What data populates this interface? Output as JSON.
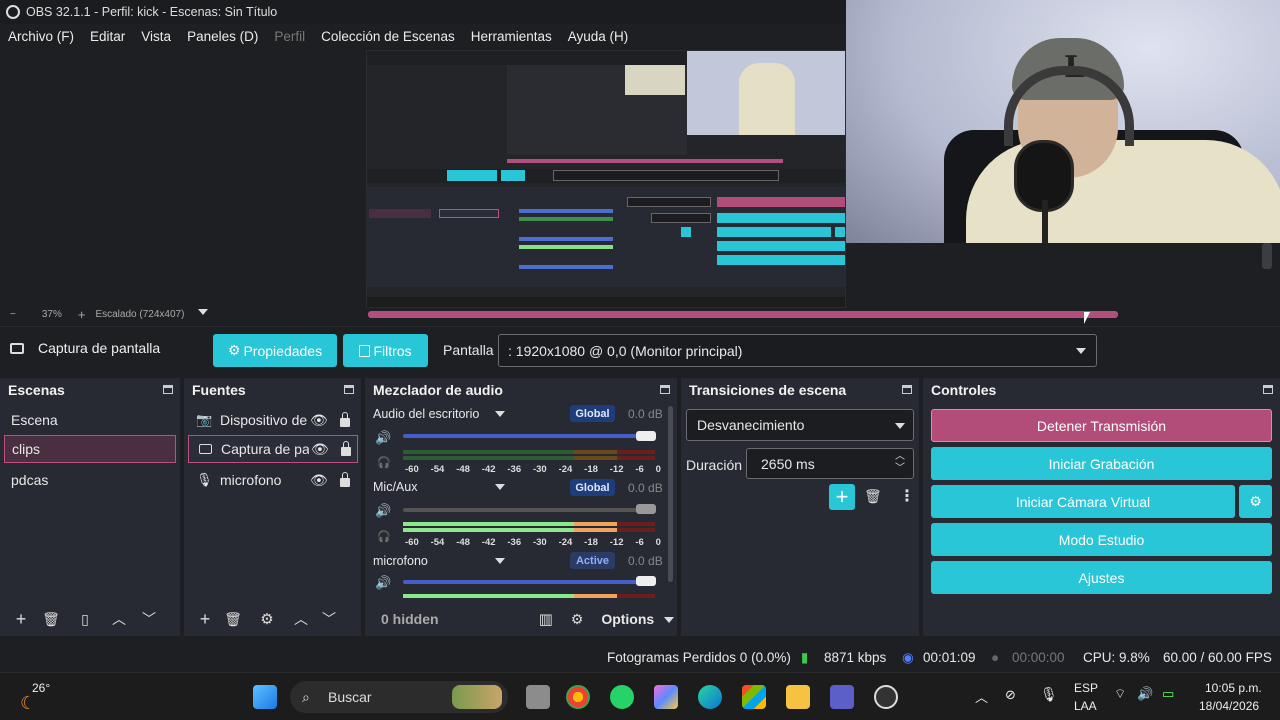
{
  "window": {
    "title": "OBS 32.1.1 - Perfil: kick - Escenas: Sin Título"
  },
  "menu": [
    "Archivo (F)",
    "Editar",
    "Vista",
    "Paneles (D)",
    "Perfil",
    "Colección de Escenas",
    "Herramientas",
    "Ayuda (H)"
  ],
  "zoom": {
    "minus": "−",
    "value": "37%",
    "plus": "+",
    "scaling": "Escalado (724x407)"
  },
  "source_toolbar": {
    "source_name": "Captura de pantalla",
    "properties_label": "Propiedades",
    "filters_label": "Filtros",
    "display_label": "Pantalla",
    "display_value": ": 1920x1080 @ 0,0 (Monitor principal)"
  },
  "scenes": {
    "title": "Escenas",
    "items": [
      {
        "label": "Escena",
        "selected": false
      },
      {
        "label": "clips",
        "selected": true
      },
      {
        "label": "pdcas",
        "selected": false
      }
    ]
  },
  "sources": {
    "title": "Fuentes",
    "items": [
      {
        "label": "Dispositivo de",
        "icon": "camera-icon"
      },
      {
        "label": "Captura de pa",
        "icon": "monitor-icon",
        "selected": true
      },
      {
        "label": "microfono",
        "icon": "microphone-icon"
      }
    ]
  },
  "mixer": {
    "title": "Mezclador de audio",
    "channels": [
      {
        "name": "Audio del escritorio",
        "badge": "Global",
        "db": "0.0 dB"
      },
      {
        "name": "Mic/Aux",
        "badge": "Global",
        "db": "0.0 dB"
      },
      {
        "name": "microfono",
        "badge": "Active",
        "db": "0.0 dB"
      }
    ],
    "scale": [
      "-60",
      "-54",
      "-48",
      "-42",
      "-36",
      "-30",
      "-24",
      "-18",
      "-12",
      "-6",
      "0"
    ],
    "hidden": "0 hidden",
    "options": "Options"
  },
  "transitions": {
    "title": "Transiciones de escena",
    "selected": "Desvanecimiento",
    "duration_label": "Duración",
    "duration_value": "2650 ms"
  },
  "controls": {
    "title": "Controles",
    "stop_stream": "Detener Transmisión",
    "start_record": "Iniciar Grabación",
    "start_vcam": "Iniciar Cámara Virtual",
    "studio_mode": "Modo Estudio",
    "settings": "Ajustes"
  },
  "status": {
    "dropped_frames": "Fotogramas Perdidos 0 (0.0%)",
    "bitrate": "8871 kbps",
    "stream_time": "00:01:09",
    "record_time": "00:00:00",
    "cpu": "CPU: 9.8%",
    "fps": "60.00 / 60.00 FPS"
  },
  "taskbar": {
    "weather_temp": "26°",
    "search_placeholder": "Buscar",
    "lang_top": "ESP",
    "lang_bottom": "LAA",
    "time": "10:05 p.m.",
    "date": "18/04/2026"
  },
  "colors": {
    "accent": "#28c6d6",
    "stream_active": "#b24d79",
    "selection": "#c04e81",
    "dock_bg": "#272a33"
  }
}
